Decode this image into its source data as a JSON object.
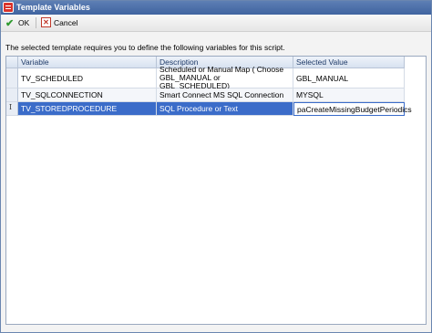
{
  "window": {
    "title": "Template Variables",
    "icon": "app-icon"
  },
  "toolbar": {
    "ok_label": "OK",
    "ok_icon": "checkmark-icon",
    "cancel_label": "Cancel",
    "cancel_icon": "cancel-icon"
  },
  "message": "The selected template requires you to define the following variables for this script.",
  "grid": {
    "columns": [
      "Variable",
      "Description",
      "Selected Value"
    ],
    "rows": [
      {
        "variable": "TV_SCHEDULED",
        "description": "Scheduled or Manual Map ( Choose GBL_MANUAL or GBL_SCHEDULED)",
        "value": "GBL_MANUAL"
      },
      {
        "variable": "TV_SQLCONNECTION",
        "description": "Smart Connect MS SQL Connection",
        "value": "MYSQL"
      },
      {
        "variable": "TV_STOREDPROCEDURE",
        "description": "SQL Procedure or Text",
        "value": "paCreateMissingBudgetPeriodics"
      }
    ],
    "selected_row": 3
  },
  "colors": {
    "titlebar": "#4a6ea8",
    "selection": "#3b6cc9"
  }
}
